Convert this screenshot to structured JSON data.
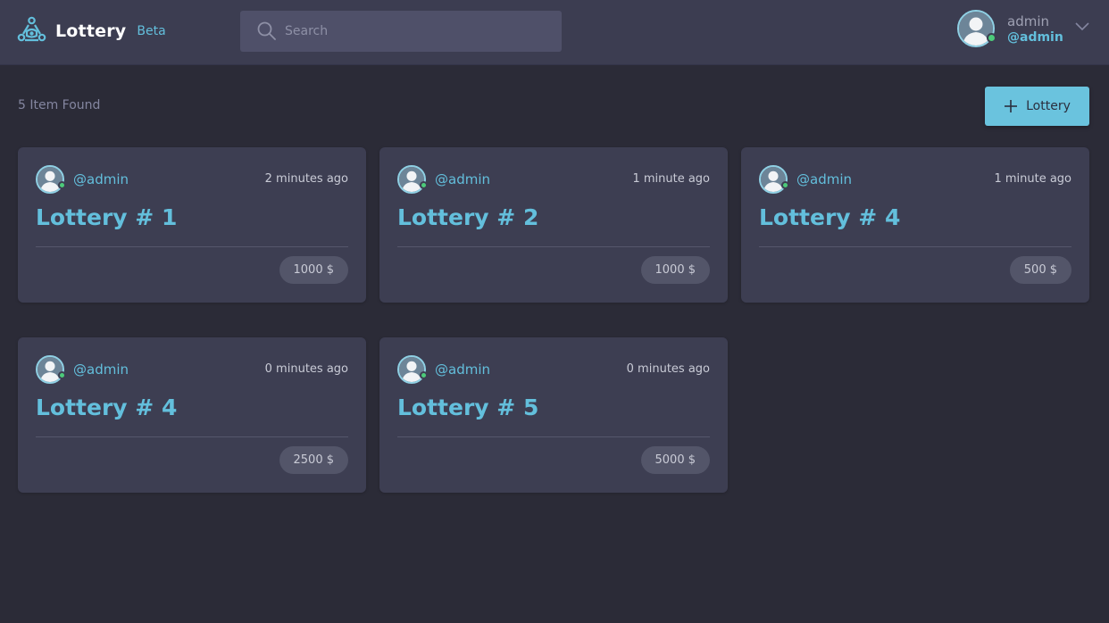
{
  "app": {
    "name": "Lottery",
    "badge": "Beta",
    "accent": "#63bfdc"
  },
  "search": {
    "placeholder": "Search",
    "value": ""
  },
  "user": {
    "name": "admin",
    "handle": "@admin",
    "status": "online"
  },
  "toolbar": {
    "count_label": "5 Item Found",
    "add_label": "Lottery"
  },
  "lotteries": [
    {
      "handle": "@admin",
      "time": "2 minutes ago",
      "title": "Lottery # 1",
      "price": "1000 $"
    },
    {
      "handle": "@admin",
      "time": "1 minute ago",
      "title": "Lottery # 2",
      "price": "1000 $"
    },
    {
      "handle": "@admin",
      "time": "1 minute ago",
      "title": "Lottery # 4",
      "price": "500 $"
    },
    {
      "handle": "@admin",
      "time": "0 minutes ago",
      "title": "Lottery # 4",
      "price": "2500 $"
    },
    {
      "handle": "@admin",
      "time": "0 minutes ago",
      "title": "Lottery # 5",
      "price": "5000 $"
    }
  ]
}
